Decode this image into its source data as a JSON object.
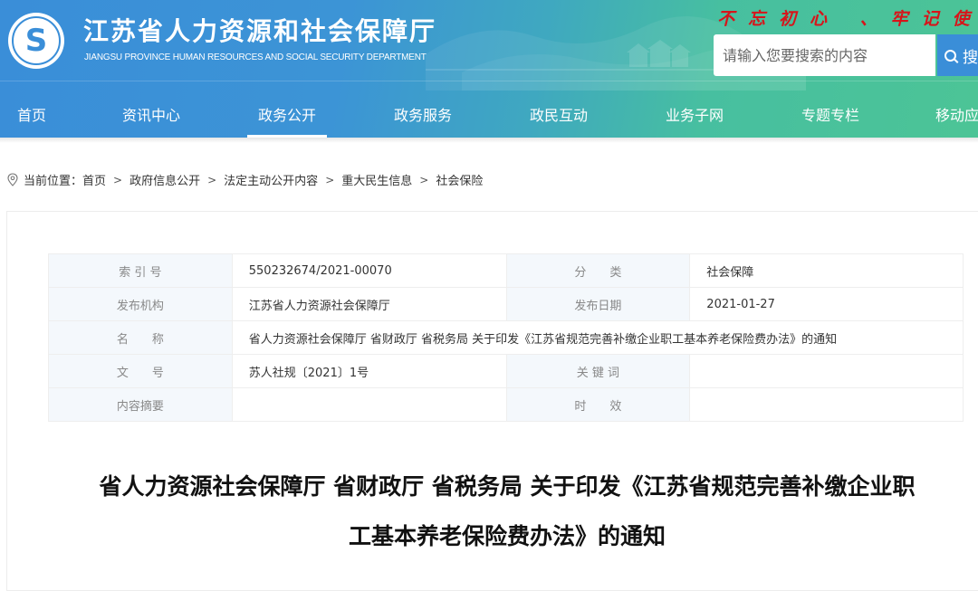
{
  "header": {
    "site_title": "江苏省人力资源和社会保障厅",
    "site_subtitle": "JIANGSU PROVINCE HUMAN RESOURCES AND SOCIAL SECURITY DEPARTMENT",
    "slogan": "不忘初心 、牢记使",
    "logo_icon": "social-security-s-logo",
    "search": {
      "placeholder": "请输入您要搜索的内容",
      "value": "",
      "button_label": "搜",
      "button_icon": "search-icon"
    },
    "colors": {
      "gradient_start": "#3a8ed8",
      "gradient_end": "#4cc496",
      "slogan": "#d7141a",
      "search_button": "#3a8ed8"
    }
  },
  "nav": {
    "items": [
      {
        "label": "首页",
        "active": false
      },
      {
        "label": "资讯中心",
        "active": false
      },
      {
        "label": "政务公开",
        "active": true
      },
      {
        "label": "政务服务",
        "active": false
      },
      {
        "label": "政民互动",
        "active": false
      },
      {
        "label": "业务子网",
        "active": false
      },
      {
        "label": "专题专栏",
        "active": false
      },
      {
        "label": "移动应",
        "active": false
      }
    ]
  },
  "breadcrumb": {
    "icon": "location-pin-icon",
    "prefix": "当前位置：",
    "separator": ">",
    "items": [
      "首页",
      "政府信息公开",
      "法定主动公开内容",
      "重大民生信息",
      "社会保险"
    ]
  },
  "meta": {
    "index_no_label": "索 引 号",
    "index_no": "550232674/2021-00070",
    "category_label": "分　　类",
    "category": "社会保障",
    "publisher_label": "发布机构",
    "publisher": "江苏省人力资源社会保障厅",
    "publish_date_label": "发布日期",
    "publish_date": "2021-01-27",
    "name_label": "名　　称",
    "name": "省人力资源社会保障厅 省财政厅 省税务局 关于印发《江苏省规范完善补缴企业职工基本养老保险费办法》的通知",
    "doc_no_label": "文　　号",
    "doc_no": "苏人社规〔2021〕1号",
    "keywords_label": "关 键 词",
    "keywords": "",
    "summary_label": "内容摘要",
    "summary": "",
    "validity_label": "时　　效",
    "validity": ""
  },
  "article": {
    "title_line1": "省人力资源社会保障厅 省财政厅 省税务局 关于印发《江苏省规范完善补缴企业职",
    "title_line2": "工基本养老保险费办法》的通知"
  }
}
